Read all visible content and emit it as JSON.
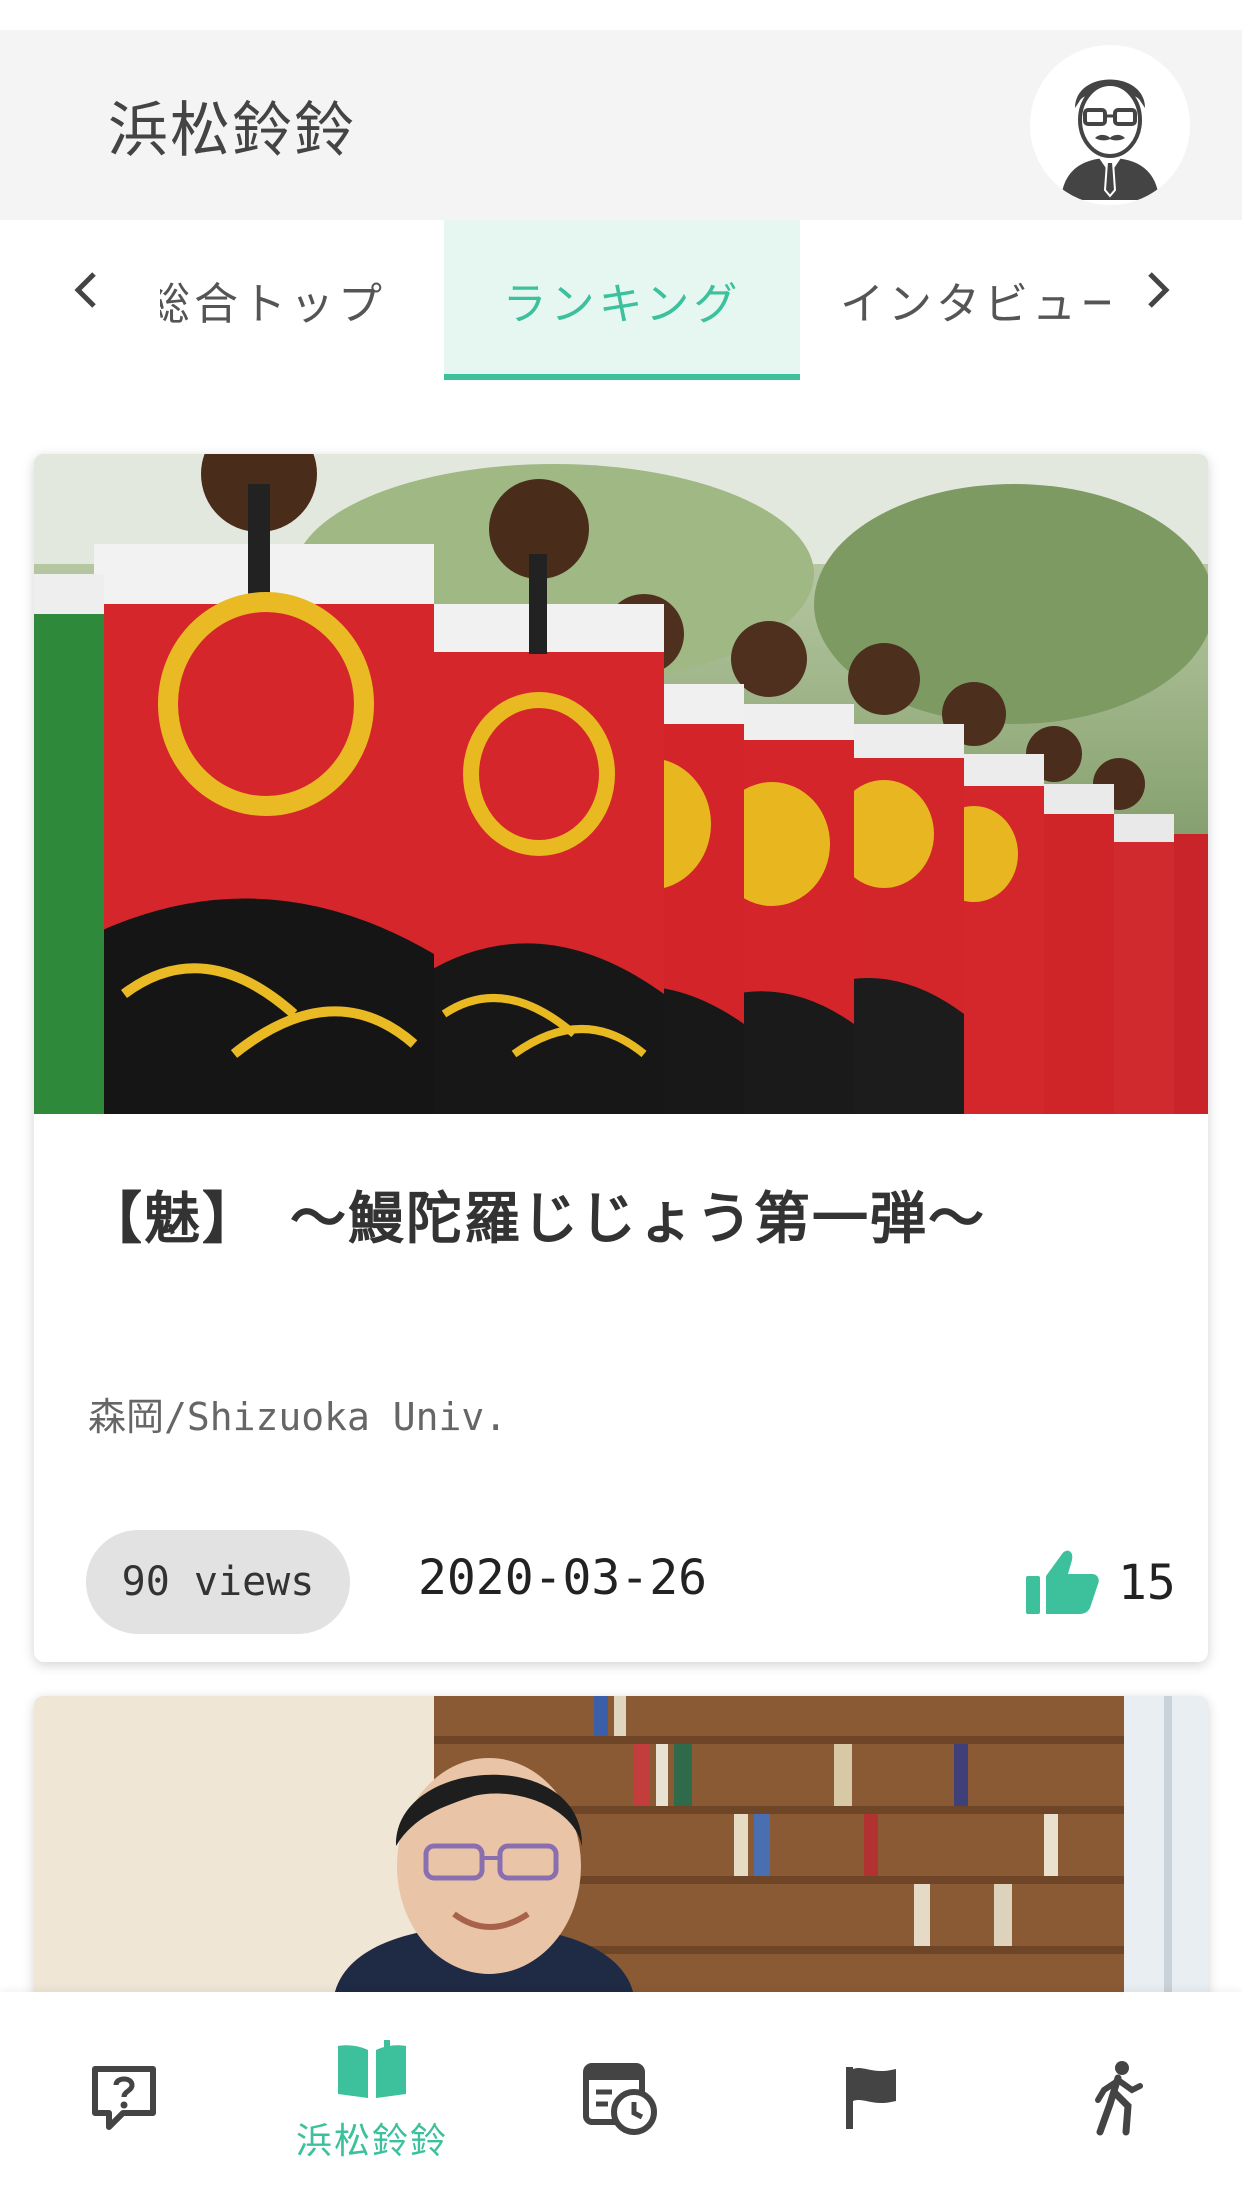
{
  "header": {
    "title": "浜松鈴鈴",
    "avatar_icon": "user-avatar-icon"
  },
  "tabs": {
    "prev_icon": "chevron-left-icon",
    "next_icon": "chevron-right-icon",
    "items": [
      {
        "label": "総合トップ",
        "active": false
      },
      {
        "label": "ランキング",
        "active": true
      },
      {
        "label": "インタビュー",
        "active": false
      }
    ]
  },
  "cards": [
    {
      "image": "festival-dancers-photo",
      "title": "【魅】　～鰻陀羅じじょう第一弾～",
      "author": "森岡/Shizuoka Univ.",
      "views": "90 views",
      "date": "2020-03-26",
      "likes": "15"
    },
    {
      "image": "interview-portrait-photo"
    }
  ],
  "bottom_nav": {
    "items": [
      {
        "icon": "question-bubble-icon",
        "label": ""
      },
      {
        "icon": "open-book-icon",
        "label": "浜松鈴鈴"
      },
      {
        "icon": "schedule-clock-icon",
        "label": ""
      },
      {
        "icon": "flag-icon",
        "label": ""
      },
      {
        "icon": "walking-person-icon",
        "label": ""
      }
    ]
  },
  "colors": {
    "accent": "#3cc19c",
    "accent_light": "#e6f7f2",
    "header_bg": "#f4f4f4",
    "badge_bg": "#e2e2e2",
    "icon_dark": "#444444"
  }
}
